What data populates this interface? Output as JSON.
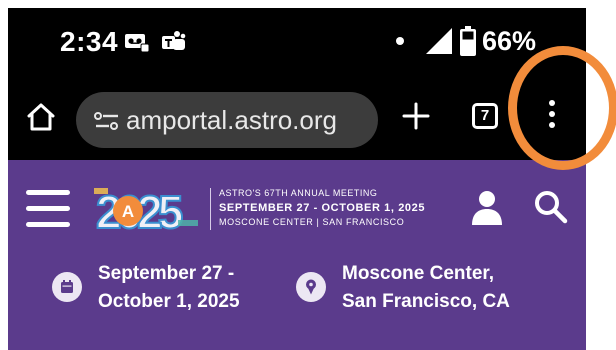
{
  "status_bar": {
    "time": "2:34",
    "notification_icons": [
      "voicemail-icon",
      "teams-icon"
    ],
    "battery_percent": "66%",
    "icons": [
      "dot-indicator-icon",
      "signal-icon",
      "battery-icon"
    ]
  },
  "browser": {
    "url": "amportal.astro.org",
    "tab_count": "7",
    "icons": [
      "home-icon",
      "site-settings-icon",
      "plus-icon",
      "tabs-icon",
      "more-vert-icon"
    ]
  },
  "site": {
    "logo_text": "2025",
    "meeting_line1": "ASTRO'S 67TH ANNUAL MEETING",
    "meeting_line2": "SEPTEMBER 27 - OCTOBER 1, 2025",
    "meeting_line3": "MOSCONE CENTER  |  SAN FRANCISCO",
    "date_line1": "September 27 -",
    "date_line2": "October 1, 2025",
    "location_line1": "Moscone Center,",
    "location_line2": "San Francisco, CA",
    "icons": [
      "menu-icon",
      "user-icon",
      "search-icon",
      "calendar-icon",
      "location-pin-icon"
    ]
  },
  "colors": {
    "site_purple": "#5b3b8c",
    "url_bar": "#3c3c3c",
    "annotation_ring": "#f28c3b"
  }
}
